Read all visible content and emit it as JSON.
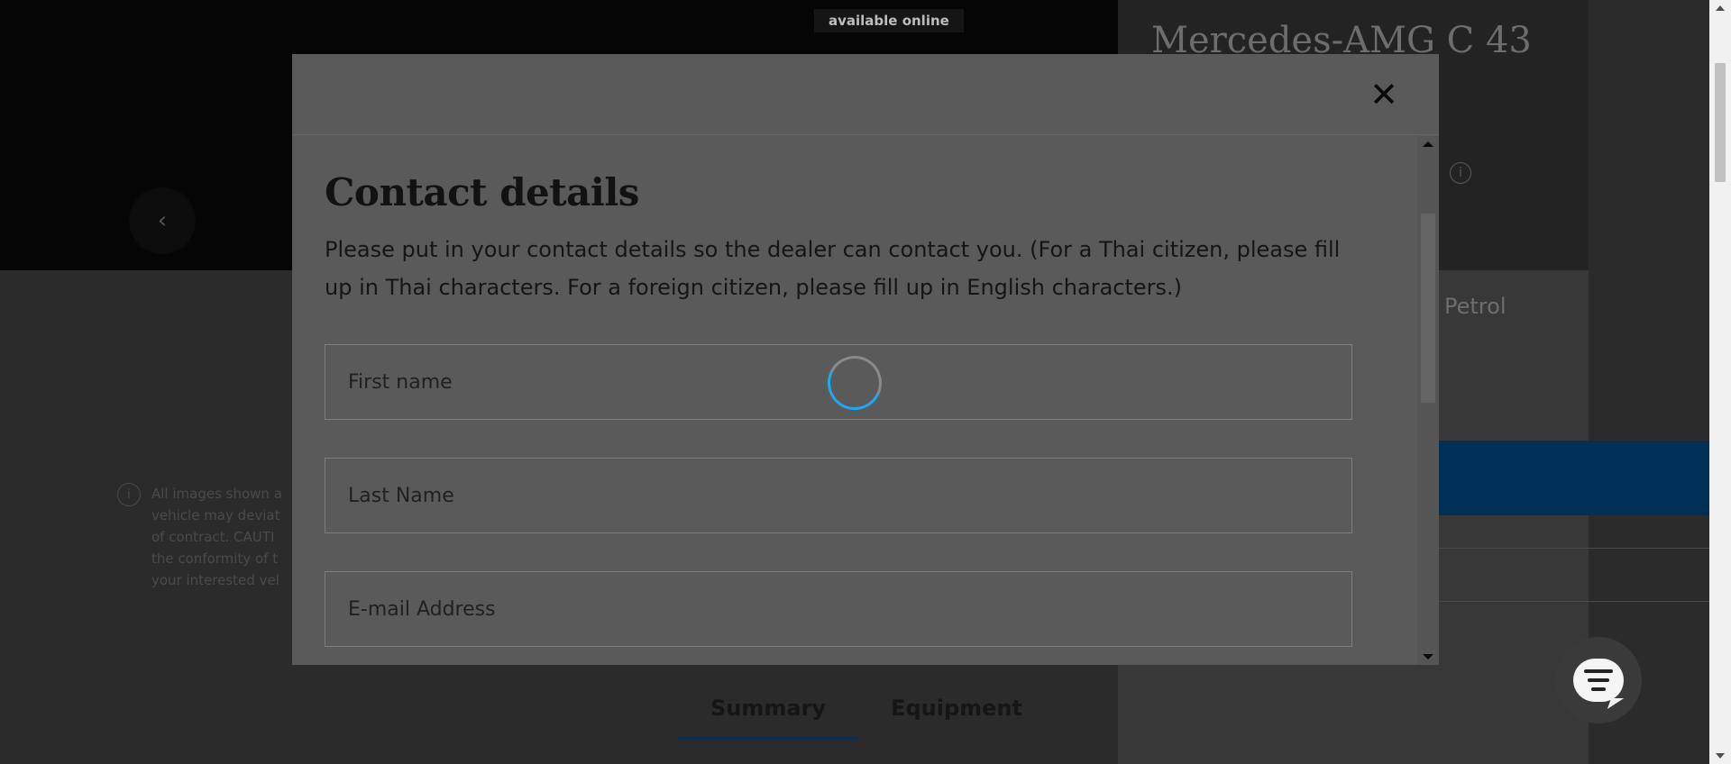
{
  "background": {
    "hero_badge": "available online",
    "prev_icon": "‹",
    "car_title": "Mercedes-AMG C 43",
    "info_icon": "i",
    "fuel_type": "Petrol",
    "disclaimer_text": "All images shown a... vehicle may deviat... of contract. CAUTI... the conformity of t... your interested vel...",
    "disclaimer_lines": [
      "All images shown a",
      "vehicle may deviat",
      "of contract. CAUTI",
      "the conformity of t",
      "your interested vel"
    ],
    "tabs": [
      {
        "label": "Summary",
        "active": true
      },
      {
        "label": "Equipment",
        "active": false
      }
    ]
  },
  "modal": {
    "close_icon": "✕",
    "title": "Contact details",
    "description": "Please put in your contact details so the dealer can contact you. (For a Thai citizen, please fill up in Thai characters. For a foreign citizen, please fill up in English characters.)",
    "fields": [
      {
        "placeholder": "First name",
        "value": ""
      },
      {
        "placeholder": "Last Name",
        "value": ""
      },
      {
        "placeholder": "E-mail Address",
        "value": ""
      }
    ]
  },
  "colors": {
    "accent": "#1eaaf1",
    "overlay": "#5a5a5a"
  }
}
